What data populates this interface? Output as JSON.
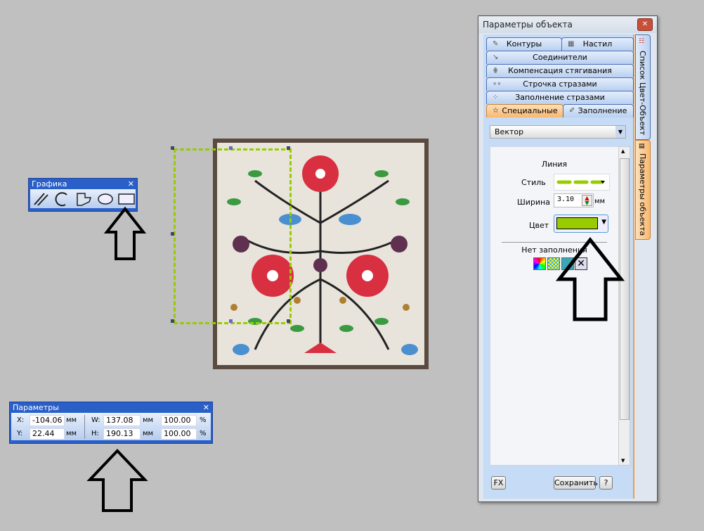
{
  "graphics_toolbar": {
    "title": "Графика",
    "close": "✕",
    "tools": [
      "line-tool",
      "arc-tool",
      "polygon-tool",
      "ellipse-tool",
      "rectangle-tool"
    ]
  },
  "params_toolbar": {
    "title": "Параметры",
    "close": "✕",
    "x_label": "X:",
    "x_value": "-104.06",
    "y_label": "Y:",
    "y_value": "22.44",
    "w_label": "W:",
    "w_value": "137.08",
    "h_label": "H:",
    "h_value": "190.13",
    "unit": "мм",
    "w_percent": "100.00",
    "h_percent": "100.00",
    "percent": "%"
  },
  "panel": {
    "title": "Параметры объекта",
    "close": "✕",
    "tabs": {
      "contours": "Контуры",
      "fill_stitch": "Настил",
      "connectors": "Соединители",
      "compensation": "Компенсация стягивания",
      "rhinestone_line": "Строчка стразами",
      "rhinestone_fill": "Заполнение стразами",
      "special": "Специальные",
      "fill": "Заполнение"
    },
    "side_tabs": {
      "color_list": "Список Цвет-Объект",
      "object_params": "Параметры объекта"
    },
    "type_select": "Вектор",
    "line_section": "Линия",
    "style_label": "Стиль",
    "width_label": "Ширина",
    "width_value": "3.10",
    "width_unit": "мм",
    "color_label": "Цвет",
    "line_color": "#99cc00",
    "fill_section": "Нет заполнения",
    "fx_button": "FX",
    "save_button": "Сохранить",
    "help_button": "?"
  },
  "selection_color": "#99cc00"
}
